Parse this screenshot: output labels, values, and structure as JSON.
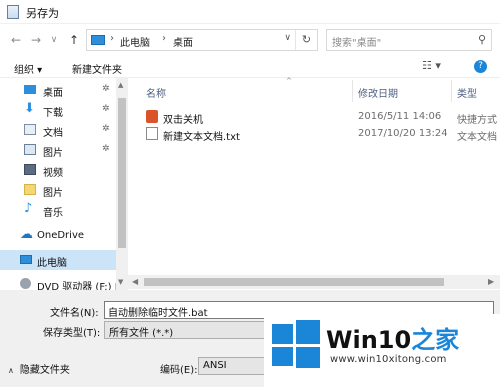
{
  "window": {
    "title": "另存为"
  },
  "nav": {
    "back_icon": "←",
    "forward_icon": "→",
    "dropdown_icon": "∨",
    "up_icon": "↑",
    "breadcrumb_sep": "›",
    "breadcrumbs": [
      "此电脑",
      "桌面"
    ],
    "refresh_icon": "↻",
    "search_placeholder": "搜索\"桌面\"",
    "search_icon": "⚲"
  },
  "toolbar": {
    "organize_label": "组织 ▾",
    "new_folder_label": "新建文件夹",
    "view_icon": "☷ ▾",
    "help_icon": "?"
  },
  "sidebar": {
    "pin_icon": "✲",
    "items": [
      {
        "label": "桌面",
        "icon": "desktop-icon",
        "pinned": true
      },
      {
        "label": "下载",
        "icon": "download-icon",
        "pinned": true
      },
      {
        "label": "文档",
        "icon": "documents-icon",
        "pinned": true
      },
      {
        "label": "图片",
        "icon": "pictures-icon",
        "pinned": true
      },
      {
        "label": "视频",
        "icon": "videos-icon",
        "pinned": false
      },
      {
        "label": "图片",
        "icon": "folder-icon",
        "pinned": false
      },
      {
        "label": "音乐",
        "icon": "music-icon",
        "pinned": false
      },
      {
        "label": "OneDrive",
        "icon": "onedrive-icon",
        "pinned": false
      },
      {
        "label": "此电脑",
        "icon": "this-pc-icon",
        "pinned": false,
        "selected": true
      },
      {
        "label": "DVD 驱动器 (F:) J",
        "icon": "dvd-drive-icon",
        "pinned": false
      }
    ]
  },
  "filelist": {
    "columns": {
      "name": "名称",
      "date": "修改日期",
      "type": "类型"
    },
    "sort_indicator": "^",
    "files": [
      {
        "name": "双击关机",
        "date": "2016/5/11 14:06",
        "type": "快捷方式",
        "icon": "shortcut-icon"
      },
      {
        "name": "新建文本文档.txt",
        "date": "2017/10/20 13:24",
        "type": "文本文档",
        "icon": "text-file-icon"
      }
    ]
  },
  "form": {
    "filename_label": "文件名(N):",
    "filename_value": "自动删除临时文件.bat",
    "savetype_label": "保存类型(T):",
    "savetype_value": "所有文件 (*.*)",
    "encoding_label": "编码(E):",
    "encoding_value": "ANSI",
    "hide_folders_label": "隐藏文件夹",
    "hide_folders_caret": "∧"
  },
  "watermark": {
    "title_main": "Win10",
    "title_accent": "之家",
    "url": "www.win10xitong.com"
  },
  "colors": {
    "accent": "#1b86d8",
    "selection": "#cce4f7",
    "header_text": "#4d6082"
  }
}
